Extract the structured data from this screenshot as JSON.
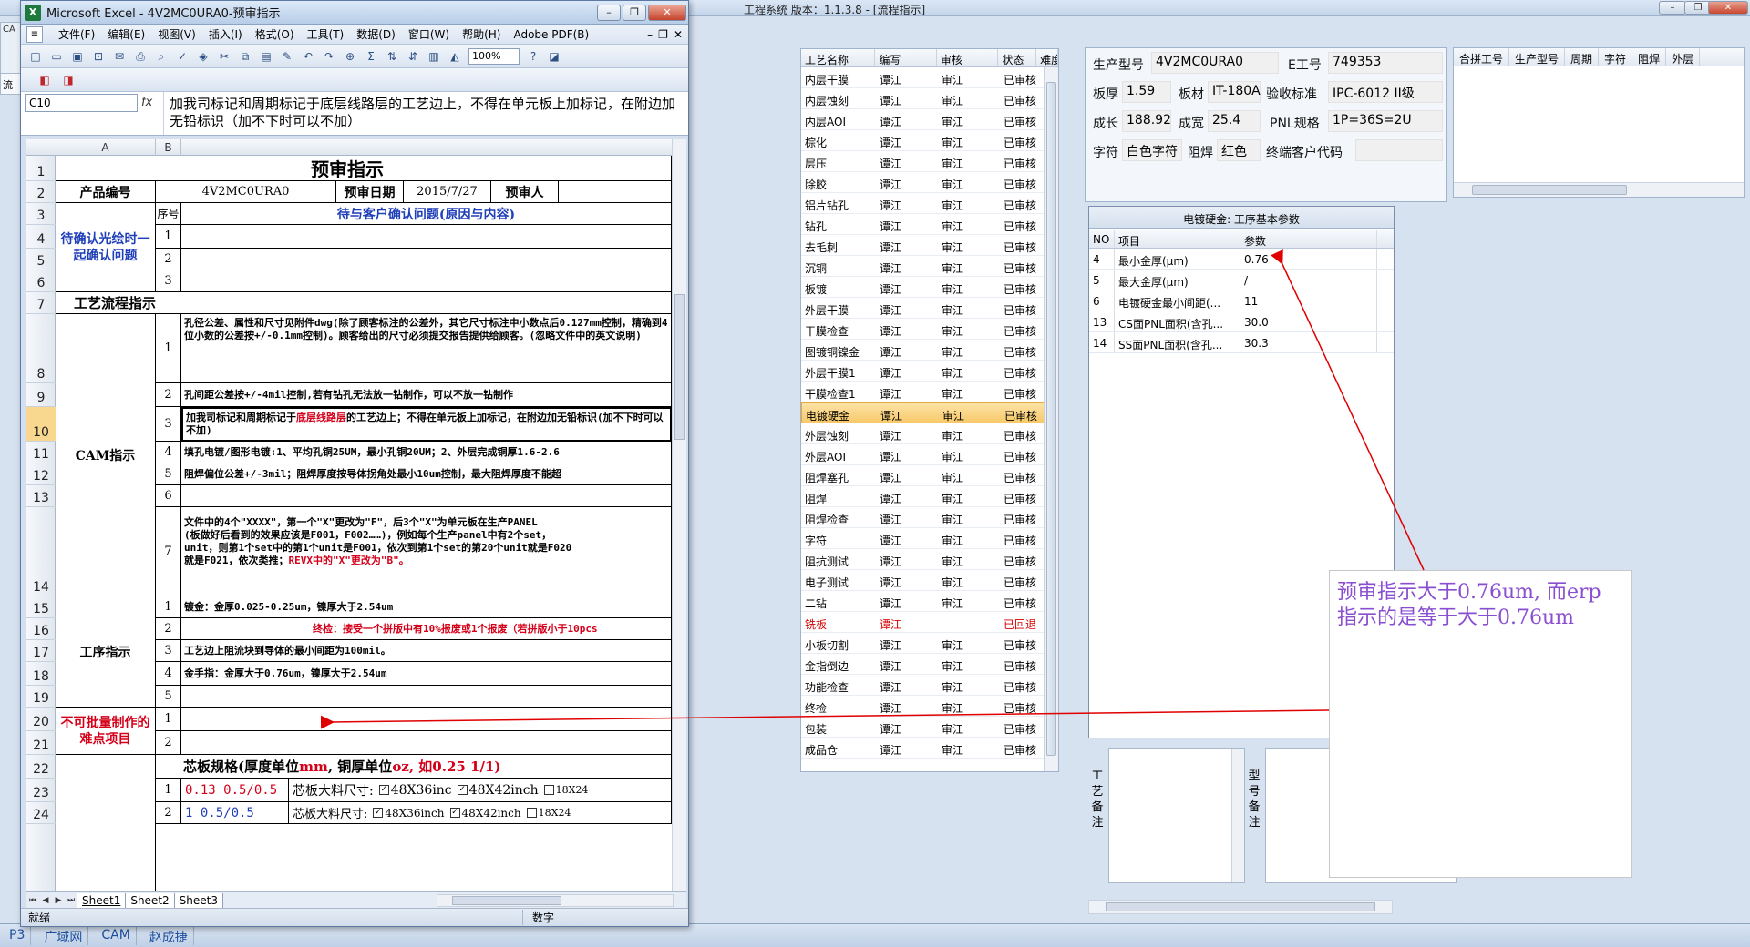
{
  "app": {
    "title": "工程系统   版本：1.1.3.8 - [流程指示]",
    "left_tab_a": "CA",
    "left_tab_b": "流"
  },
  "process_list": {
    "headers": [
      "工艺名称",
      "编写",
      "审核",
      "状态",
      "难度"
    ],
    "rows": [
      {
        "name": "内层干膜",
        "writer": "谭江",
        "reviewer": "审江",
        "status": "已审核"
      },
      {
        "name": "内层蚀刻",
        "writer": "谭江",
        "reviewer": "审江",
        "status": "已审核"
      },
      {
        "name": "内层AOI",
        "writer": "谭江",
        "reviewer": "审江",
        "status": "已审核"
      },
      {
        "name": "棕化",
        "writer": "谭江",
        "reviewer": "审江",
        "status": "已审核"
      },
      {
        "name": "层压",
        "writer": "谭江",
        "reviewer": "审江",
        "status": "已审核"
      },
      {
        "name": "除胶",
        "writer": "谭江",
        "reviewer": "审江",
        "status": "已审核"
      },
      {
        "name": "铝片钻孔",
        "writer": "谭江",
        "reviewer": "审江",
        "status": "已审核"
      },
      {
        "name": "钻孔",
        "writer": "谭江",
        "reviewer": "审江",
        "status": "已审核"
      },
      {
        "name": "去毛刺",
        "writer": "谭江",
        "reviewer": "审江",
        "status": "已审核"
      },
      {
        "name": "沉铜",
        "writer": "谭江",
        "reviewer": "审江",
        "status": "已审核"
      },
      {
        "name": "板镀",
        "writer": "谭江",
        "reviewer": "审江",
        "status": "已审核"
      },
      {
        "name": "外层干膜",
        "writer": "谭江",
        "reviewer": "审江",
        "status": "已审核"
      },
      {
        "name": "干膜检查",
        "writer": "谭江",
        "reviewer": "审江",
        "status": "已审核"
      },
      {
        "name": "图镀铜镍金",
        "writer": "谭江",
        "reviewer": "审江",
        "status": "已审核"
      },
      {
        "name": "外层干膜1",
        "writer": "谭江",
        "reviewer": "审江",
        "status": "已审核"
      },
      {
        "name": "干膜检查1",
        "writer": "谭江",
        "reviewer": "审江",
        "status": "已审核"
      },
      {
        "name": "电镀硬金",
        "writer": "谭江",
        "reviewer": "审江",
        "status": "已审核",
        "selected": true
      },
      {
        "name": "外层蚀刻",
        "writer": "谭江",
        "reviewer": "审江",
        "status": "已审核"
      },
      {
        "name": "外层AOI",
        "writer": "谭江",
        "reviewer": "审江",
        "status": "已审核"
      },
      {
        "name": "阻焊塞孔",
        "writer": "谭江",
        "reviewer": "审江",
        "status": "已审核"
      },
      {
        "name": "阻焊",
        "writer": "谭江",
        "reviewer": "审江",
        "status": "已审核"
      },
      {
        "name": "阻焊检查",
        "writer": "谭江",
        "reviewer": "审江",
        "status": "已审核"
      },
      {
        "name": "字符",
        "writer": "谭江",
        "reviewer": "审江",
        "status": "已审核"
      },
      {
        "name": "阻抗测试",
        "writer": "谭江",
        "reviewer": "审江",
        "status": "已审核"
      },
      {
        "name": "电子测试",
        "writer": "谭江",
        "reviewer": "审江",
        "status": "已审核"
      },
      {
        "name": "二钻",
        "writer": "谭江",
        "reviewer": "审江",
        "status": "已审核"
      },
      {
        "name": "铣板",
        "writer": "谭江",
        "reviewer": "",
        "status": "已回退",
        "returned": true
      },
      {
        "name": "小板切割",
        "writer": "谭江",
        "reviewer": "审江",
        "status": "已审核"
      },
      {
        "name": "金指倒边",
        "writer": "谭江",
        "reviewer": "审江",
        "status": "已审核"
      },
      {
        "name": "功能检查",
        "writer": "谭江",
        "reviewer": "审江",
        "status": "已审核"
      },
      {
        "name": "终检",
        "writer": "谭江",
        "reviewer": "审江",
        "status": "已审核"
      },
      {
        "name": "包装",
        "writer": "谭江",
        "reviewer": "审江",
        "status": "已审核"
      },
      {
        "name": "成品仓",
        "writer": "谭江",
        "reviewer": "审江",
        "status": "已审核"
      }
    ]
  },
  "info": {
    "model_label": "生产型号",
    "model_value": "4V2MC0URA0",
    "eorder_label": "E工号",
    "eorder_value": "749353",
    "thickness_label": "板厚",
    "thickness_value": "1.59",
    "material_label": "板材",
    "material_value": "IT-180A",
    "standard_label": "验收标准",
    "standard_value": "IPC-6012 II级",
    "length_label": "成长",
    "length_value": "188.92",
    "width_label": "成宽",
    "width_value": "25.4",
    "pnl_label": "PNL规格",
    "pnl_value": "1P=36S=2U",
    "char_label": "字符",
    "char_value": "白色字符",
    "mask_label": "阻焊",
    "mask_value": "红色",
    "cust_label": "终端客户代码",
    "cust_value": ""
  },
  "merge_table": {
    "headers": [
      "合拼工号",
      "生产型号",
      "周期",
      "字符",
      "阻焊",
      "外层"
    ]
  },
  "params": {
    "title": "电镀硬金: 工序基本参数",
    "headers": [
      "NO",
      "项目",
      "参数"
    ],
    "rows": [
      {
        "no": "4",
        "item": "最小金厚(μm)",
        "value": "0.76"
      },
      {
        "no": "5",
        "item": "最大金厚(μm)",
        "value": "/"
      },
      {
        "no": "6",
        "item": "电镀硬金最小间距(...",
        "value": "11"
      },
      {
        "no": "13",
        "item": "CS面PNL面积(含孔...",
        "value": "30.0"
      },
      {
        "no": "14",
        "item": "SS面PNL面积(含孔...",
        "value": "30.3"
      }
    ]
  },
  "notes": {
    "process_note_label": "工艺备注",
    "model_note_label": "型号备注"
  },
  "taskbar": [
    "P3",
    "广域网",
    "CAM",
    "赵成捷"
  ],
  "excel": {
    "title": "Microsoft Excel - 4V2MC0URA0-预审指示",
    "logo": "X",
    "menu_icon": "≡",
    "menus": [
      "文件(F)",
      "编辑(E)",
      "视图(V)",
      "插入(I)",
      "格式(O)",
      "工具(T)",
      "数据(D)",
      "窗口(W)",
      "帮助(H)",
      "Adobe PDF(B)"
    ],
    "zoom": "100%",
    "namebox": "C10",
    "fx": "fx",
    "formula": "加我司标记和周期标记于底层线路层的工艺边上，不得在单元板上加标记，在附边加无铅标识（加不下时可以不加）",
    "col_a": "A",
    "col_b": "B",
    "sheets": [
      "Sheet1",
      "Sheet2",
      "Sheet3"
    ],
    "status_ready": "就绪",
    "status_num": "数字"
  },
  "sheet": {
    "title": "预审指示",
    "product_no_label": "产品编号",
    "product_no": "4V2MC0URA0",
    "review_date_label": "预审日期",
    "review_date": "2015/7/27",
    "reviewer_label": "预审人",
    "seq_label": "序号",
    "customer_q_label": "待与客户确认问题(原因与内容)",
    "photo_confirm": "待确认光绘时一起确认问题",
    "process_flow": "工艺流程指示",
    "cam_label": "CAM指示",
    "cam_1": "孔径公差、属性和尺寸见附件dwg(除了顾客标注的公差外，其它尺寸标注中小数点后0.127mm控制，精确到4位小数的公差按+/-0.1mm控制)。顾客给出的尺寸必须提交报告提供给顾客。(忽略文件中的英文说明)",
    "cam_2": "孔间距公差按+/-4mil控制,若有钻孔无法放一钻制作，可以不放一钻制作",
    "cam_3a": "加我司标记和周期标记于",
    "cam_3b": "底层线路层",
    "cam_3c": "的工艺边上；不得在单元板上加标记，在附边加无铅标识(加不下时可以不加)",
    "cam_4": "填孔电镀/图形电镀:1、平均孔铜25UM，最小孔铜20UM；2、外层完成铜厚1.6-2.6",
    "cam_5": "阻焊偏位公差+/-3mil；阻焊厚度按导体拐角处最小10um控制，最大阻焊厚度不能超",
    "cam_7a": "文件中的4个\"XXXX\"，第一个\"X\"更改为\"F\"，后3个\"X\"为单元板在生产PANEL",
    "cam_7b": "(板做好后看到的效果应该是F001，F002……)，例如每个生产panel中有2个set，",
    "cam_7c": "unit，则第1个set中的第1个unit是F001，依次到第1个set的第20个unit就是F020",
    "cam_7d": "就是F021，依次类推；",
    "cam_7e": "REVX中的\"X\"更改为\"B\"。",
    "op_label": "工序指示",
    "op_1": "镀金：金厚0.025-0.25um，镍厚大于2.54um",
    "op_2": "终检：接受一个拼版中有10%报废或1个报废（若拼版小于10pcs",
    "op_3": "工艺边上阻流块到导体的最小间距为100mil。",
    "op_4": "金手指：金厚大于0.76um，镍厚大于2.54um",
    "difficulty_label": "不可批量制作的难点项目",
    "core_label_a": "芯板规格(厚度单位",
    "core_label_b": "mm",
    "core_label_c": ", 铜厚单位",
    "core_label_d": "oz",
    "core_label_e": ", 如0.25 1/1)",
    "core_1": "0.13 0.5/0.5",
    "core_2": "1 0.5/0.5",
    "core_size_label": "芯板大料尺寸:",
    "size_opt_1": "48X36inc",
    "size_opt_2": "48X42inch",
    "size_opt_3": "18X24",
    "size_opt_1b": "48X36inch",
    "size_opt_2b": "48X42inch",
    "size_opt_3b": "18X24",
    "nums": [
      "1",
      "2",
      "3",
      "4",
      "5",
      "6",
      "7"
    ]
  },
  "annotation": {
    "line1": "预审指示大于0.76um, 而erp",
    "line2": "指示的是等于大于0.76um"
  }
}
